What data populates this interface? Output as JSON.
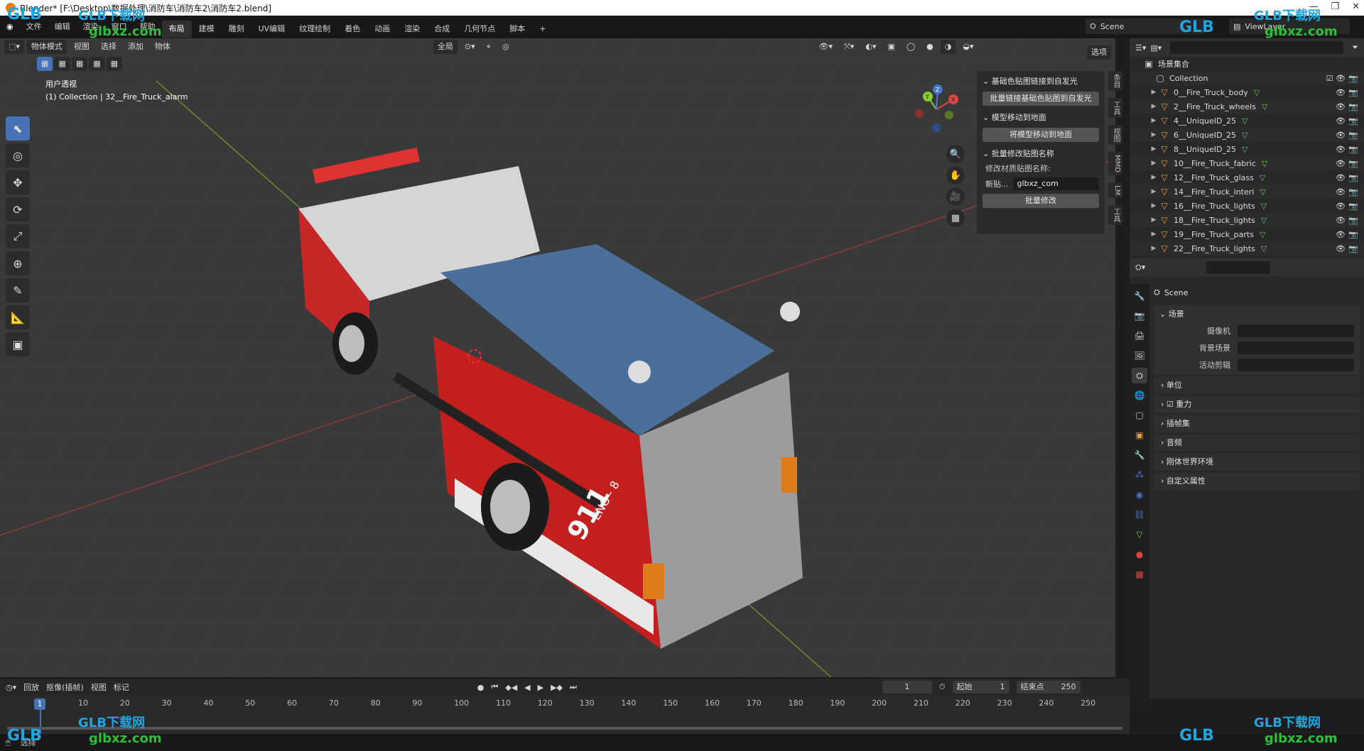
{
  "window": {
    "title": "Blender* [F:\\Desktop\\数据处理\\消防车\\消防车2\\消防车2.blend]",
    "controls": [
      "—",
      "❐",
      "✕"
    ]
  },
  "menu": [
    "文件",
    "编辑",
    "渲染",
    "窗口",
    "帮助"
  ],
  "workspaces": [
    {
      "label": "布局",
      "active": true
    },
    {
      "label": "建模"
    },
    {
      "label": "雕刻"
    },
    {
      "label": "UV编辑"
    },
    {
      "label": "纹理绘制"
    },
    {
      "label": "着色"
    },
    {
      "label": "动画"
    },
    {
      "label": "渲染"
    },
    {
      "label": "合成"
    },
    {
      "label": "几何节点"
    },
    {
      "label": "脚本"
    },
    {
      "label": "+"
    }
  ],
  "scene_field": "Scene",
  "viewlayer_field": "ViewLayer",
  "viewport": {
    "mode": "物体模式",
    "menus": [
      "视图",
      "选择",
      "添加",
      "物体"
    ],
    "transform_orientation": "全局",
    "options_label": "选项",
    "info_line1": "用户透视",
    "info_line2": "(1) Collection | 32__Fire_Truck_alarm",
    "gizmo_axes": [
      "X",
      "Y",
      "Z"
    ],
    "truck_text": {
      "number": "911",
      "unit": "ENG - 8"
    }
  },
  "npanel": {
    "sec1_title": "基础色贴图链接到自发光",
    "sec1_button": "批量链接基础色贴图到自发光",
    "sec2_title": "模型移动到地面",
    "sec2_button": "将模型移动到地面",
    "sec3_title": "批量修改贴图名称",
    "sec3_label": "修改材质贴图名称:",
    "sec3_row_label": "新贴...",
    "sec3_input": "glbxz_com",
    "sec3_button": "批量修改"
  },
  "side_tabs": [
    "条目",
    "工具",
    "视图",
    "MMD",
    "LM",
    "工具"
  ],
  "outliner": {
    "root": "场景集合",
    "collection": "Collection",
    "items": [
      "0__Fire_Truck_body",
      "2__Fire_Truck_wheels",
      "4__UniqueID_25",
      "6__UniqueID_25",
      "8__UniqueID_25",
      "10__Fire_Truck_fabric",
      "12__Fire_Truck_glass",
      "14__Fire_Truck_interi",
      "16__Fire_Truck_lights",
      "18__Fire_Truck_lights",
      "19__Fire_Truck_parts",
      "22__Fire_Truck_lights"
    ]
  },
  "properties": {
    "title": "Scene",
    "scene_section": "场景",
    "camera_label": "摄像机",
    "bg_scene_label": "背景场景",
    "active_clip_label": "活动剪辑",
    "collapsed": [
      "单位",
      "重力",
      "插帧集",
      "音频",
      "刚体世界环境",
      "自定义属性"
    ]
  },
  "timeline": {
    "menus": [
      "回放",
      "抠像(插帧)",
      "视图",
      "标记"
    ],
    "current_frame": "1",
    "start_label": "起始",
    "start_value": "1",
    "end_label": "结束点",
    "end_value": "250",
    "ticks": [
      "10",
      "20",
      "30",
      "40",
      "50",
      "60",
      "70",
      "80",
      "90",
      "100",
      "110",
      "120",
      "130",
      "140",
      "150",
      "160",
      "170",
      "180",
      "190",
      "200",
      "210",
      "220",
      "230",
      "240",
      "250"
    ]
  },
  "status": {
    "left": "选择",
    "version": ""
  },
  "watermark": {
    "brand": "GLB下载网",
    "url": "glbxz.com",
    "logo": "GLB"
  }
}
